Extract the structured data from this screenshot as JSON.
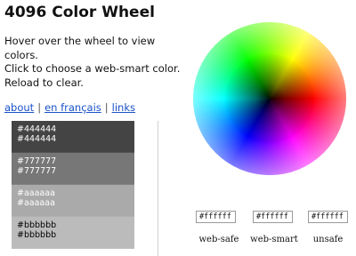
{
  "page": {
    "title": "4096 Color Wheel",
    "intro": [
      "Hover over the wheel to view colors.",
      "Click to choose a web-smart color.",
      "Reload to clear."
    ]
  },
  "nav": {
    "about": "about",
    "french": "en français",
    "links": "links",
    "separator": "|"
  },
  "swatches": [
    {
      "label1": "#444444",
      "label2": "#444444",
      "color": "#444444",
      "text_color": "#ffffff"
    },
    {
      "label1": "#777777",
      "label2": "#777777",
      "color": "#777777",
      "text_color": "#ffffff"
    },
    {
      "label1": "#aaaaaa",
      "label2": "#aaaaaa",
      "color": "#aaaaaa",
      "text_color": "#ffffff"
    },
    {
      "label1": "#bbbbbb",
      "label2": "#bbbbbb",
      "color": "#bbbbbb",
      "text_color": "#000000"
    }
  ],
  "values": {
    "web_safe": "#ffffff",
    "web_smart": "#ffffff",
    "unsafe": "#ffffff",
    "labels": {
      "web_safe": "web-safe",
      "web_smart": "web-smart",
      "unsafe": "unsafe"
    }
  }
}
